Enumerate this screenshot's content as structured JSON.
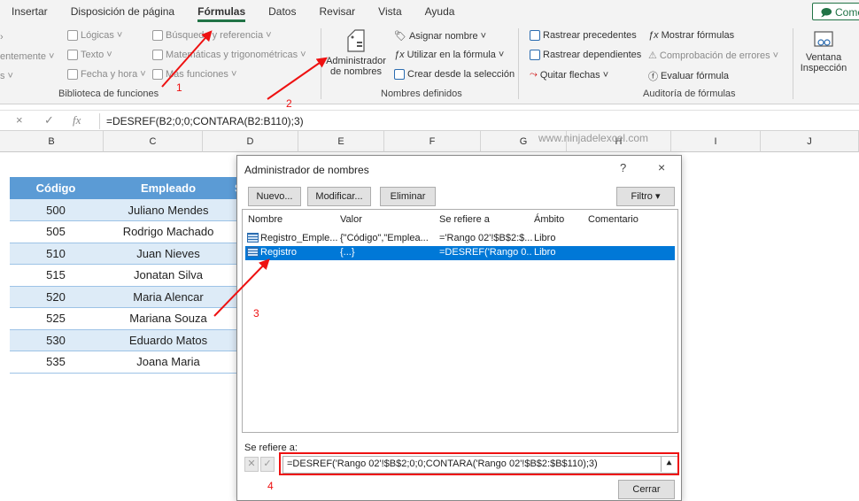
{
  "tabs": [
    "Insertar",
    "Disposición de página",
    "Fórmulas",
    "Datos",
    "Revisar",
    "Vista",
    "Ayuda"
  ],
  "active_tab": "Fórmulas",
  "comment_button": "Come",
  "ribbon": {
    "lib": {
      "logicas": "Lógicas",
      "texto": "Texto",
      "fecha_hora": "Fecha y hora",
      "busqueda": "Búsqueda y referencia",
      "matematicas": "Matemáticas y trigonométricas",
      "mas_funciones": "Más funciones",
      "cut_entemente": "entemente",
      "cut_s": "s",
      "group": "Biblioteca de funciones"
    },
    "names": {
      "admin_line1": "Administrador",
      "admin_line2": "de nombres",
      "asignar": "Asignar nombre",
      "utilizar": "Utilizar en la fórmula",
      "crear": "Crear desde la selección",
      "group": "Nombres definidos"
    },
    "audit": {
      "precedentes": "Rastrear precedentes",
      "dependientes": "Rastrear dependientes",
      "quitar": "Quitar flechas",
      "mostrar": "Mostrar fórmulas",
      "comprobacion": "Comprobación de errores",
      "evaluar": "Evaluar fórmula",
      "group": "Auditoría de fórmulas"
    },
    "ventana_line1": "Ventana",
    "ventana_line2": "Inspección"
  },
  "formula_bar": {
    "cancel": "×",
    "enter": "✓",
    "fx": "fx",
    "formula": "=DESREF(B2;0;0;CONTARA(B2:B110);3)"
  },
  "columns": [
    "B",
    "C",
    "D",
    "E",
    "F",
    "G",
    "H",
    "I",
    "J"
  ],
  "watermark": "www.ninjadelexcel.com",
  "table": {
    "headers": [
      "Código",
      "Empleado",
      "Sa"
    ],
    "rows": [
      [
        "500",
        "Juliano Mendes"
      ],
      [
        "505",
        "Rodrigo Machado"
      ],
      [
        "510",
        "Juan Nieves"
      ],
      [
        "515",
        "Jonatan Silva"
      ],
      [
        "520",
        "Maria Alencar"
      ],
      [
        "525",
        "Mariana Souza"
      ],
      [
        "530",
        "Eduardo Matos"
      ],
      [
        "535",
        "Joana Maria"
      ]
    ]
  },
  "dialog": {
    "title": "Administrador de nombres",
    "help": "?",
    "close": "×",
    "buttons": {
      "nuevo": "Nuevo...",
      "modificar": "Modificar...",
      "eliminar": "Eliminar",
      "filtro": "Filtro ▾"
    },
    "list_headers": [
      "Nombre",
      "Valor",
      "Se refiere a",
      "Ámbito",
      "Comentario"
    ],
    "rows": [
      {
        "nombre": "Registro_Emple...",
        "valor": "{\"Código\",\"Emplea...",
        "refiere": "='Rango 02'!$B$2:$...",
        "ambito": "Libro",
        "selected": false
      },
      {
        "nombre": "Registro",
        "valor": "{...}",
        "refiere": "=DESREF('Rango 0...",
        "ambito": "Libro",
        "selected": true
      }
    ],
    "refers_label": "Se refiere a:",
    "refers_value": "=DESREF('Rango 02'!$B$2;0;0;CONTARA('Rango 02'!$B$2:$B$110);3)",
    "cerrar": "Cerrar"
  },
  "annotations": [
    "1",
    "2",
    "3",
    "4"
  ],
  "colors": {
    "accent_green": "#217346",
    "table_header": "#5b9bd5",
    "table_band": "#ddebf7",
    "selection": "#0078d7",
    "annotation": "#ee1111"
  }
}
